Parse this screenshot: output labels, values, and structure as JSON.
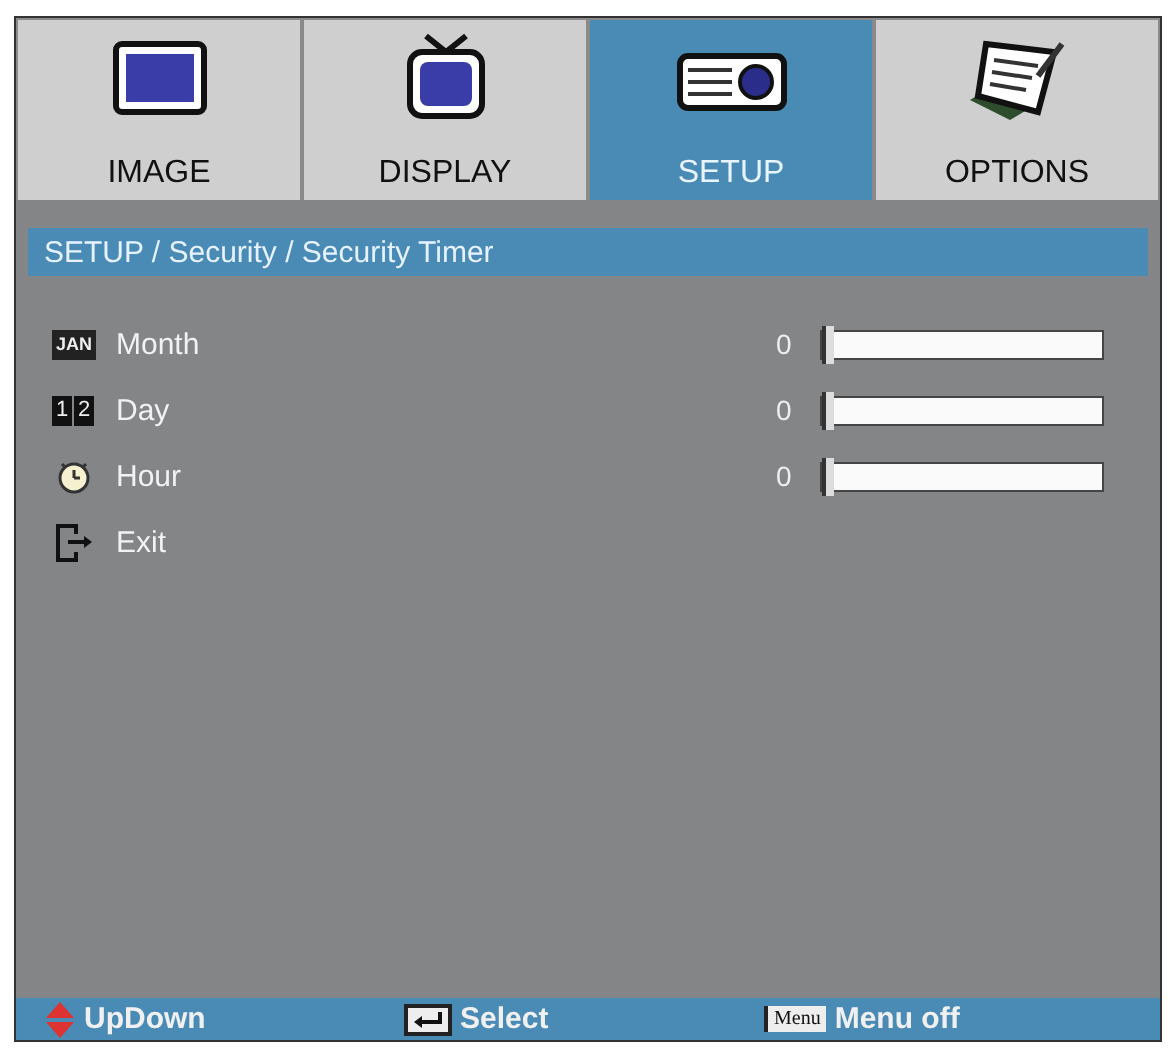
{
  "tabs": [
    {
      "label": "IMAGE",
      "selected": false
    },
    {
      "label": "DISPLAY",
      "selected": false
    },
    {
      "label": "SETUP",
      "selected": true
    },
    {
      "label": "OPTIONS",
      "selected": false
    }
  ],
  "breadcrumb": "SETUP / Security / Security Timer",
  "items": [
    {
      "kind": "slider",
      "icon_text": "JAN",
      "label": "Month",
      "reading": "0",
      "level": 0
    },
    {
      "kind": "slider",
      "icon_text": [
        "1",
        "2"
      ],
      "label": "Day",
      "reading": "0",
      "level": 0
    },
    {
      "kind": "slider",
      "label": "Hour",
      "reading": "0",
      "level": 0
    },
    {
      "kind": "action",
      "label": "Exit"
    }
  ],
  "footer": [
    {
      "label": "UpDown"
    },
    {
      "label": "Select"
    },
    {
      "key_text": "Menu",
      "label": "Menu off"
    }
  ]
}
